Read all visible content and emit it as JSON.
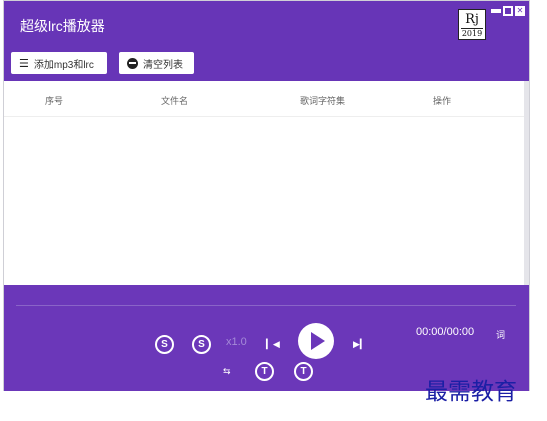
{
  "window": {
    "title": "超级lrc播放器",
    "logo_main": "Rj",
    "logo_year": "2019"
  },
  "toolbar": {
    "add_label": "添加mp3和lrc",
    "add_icon": "playlist-add-icon",
    "clear_label": "清空列表",
    "clear_icon": "minus-circle-icon"
  },
  "table": {
    "columns": [
      "序号",
      "文件名",
      "歌词字符集",
      "操作"
    ]
  },
  "player": {
    "speed": "x1.0",
    "time": "00:00/00:00",
    "lyrics": "词",
    "s_label": "S",
    "t_label": "T"
  },
  "watermark": "最需教育",
  "colors": {
    "accent": "#6735b7",
    "player_bg": "#6b37b9"
  }
}
